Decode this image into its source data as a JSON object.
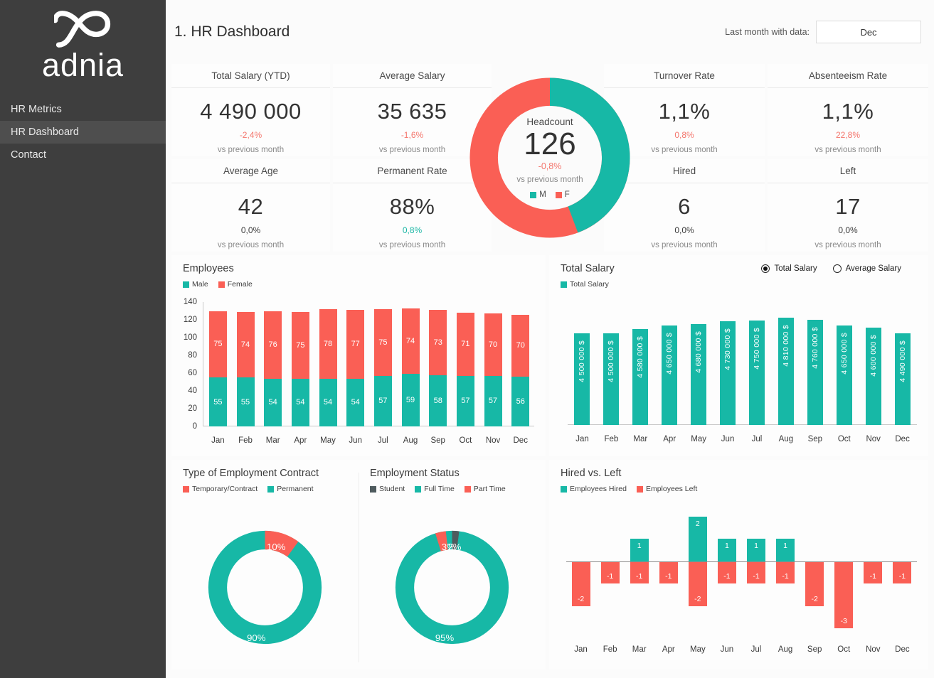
{
  "brand": {
    "name": "adnia",
    "logo_icon": "adnia-logo-icon"
  },
  "sidebar": {
    "items": [
      {
        "label": "HR Metrics",
        "active": false
      },
      {
        "label": "HR Dashboard",
        "active": true
      },
      {
        "label": "Contact",
        "active": false
      }
    ]
  },
  "header": {
    "title": "1. HR Dashboard",
    "month_label": "Last month with data:",
    "month_value": "Dec"
  },
  "colors": {
    "teal": "#17b8a6",
    "red": "#fa5f55",
    "dark_gray": "#4f5b5e",
    "sidebar": "#3e3e3e",
    "sidebar_active": "#4e4e4e"
  },
  "kpis": {
    "left": [
      {
        "title": "Total Salary (YTD)",
        "value": "4 490 000",
        "delta": "-2,4%",
        "delta_type": "neg",
        "sub": "vs previous month"
      },
      {
        "title": "Average Salary",
        "value": "35 635",
        "delta": "-1,6%",
        "delta_type": "neg",
        "sub": "vs previous month"
      },
      {
        "title": "Average Age",
        "value": "42",
        "delta": "0,0%",
        "delta_type": "flat",
        "sub": "vs previous month"
      },
      {
        "title": "Permanent Rate",
        "value": "88%",
        "delta": "0,8%",
        "delta_type": "pos",
        "sub": "vs previous month"
      }
    ],
    "right": [
      {
        "title": "Turnover Rate",
        "value": "1,1%",
        "delta": "0,8%",
        "delta_type": "neg",
        "sub": "vs previous month"
      },
      {
        "title": "Absenteeism Rate",
        "value": "1,1%",
        "delta": "22,8%",
        "delta_type": "neg",
        "sub": "vs previous month"
      },
      {
        "title": "Hired",
        "value": "6",
        "delta": "0,0%",
        "delta_type": "flat",
        "sub": "vs previous month"
      },
      {
        "title": "Left",
        "value": "17",
        "delta": "0,0%",
        "delta_type": "flat",
        "sub": "vs previous month"
      }
    ]
  },
  "headcount": {
    "label": "Headcount",
    "value": "126",
    "delta": "-0,8%",
    "sub": "vs previous month",
    "legend": [
      {
        "label": "M",
        "color": "#17b8a6"
      },
      {
        "label": "F",
        "color": "#fa5f55"
      }
    ],
    "chart_data": {
      "type": "pie",
      "title": "Headcount",
      "categories": [
        "M",
        "F"
      ],
      "values": [
        56,
        70
      ],
      "colors": [
        "#17b8a6",
        "#fa5f55"
      ]
    }
  },
  "charts": {
    "employees": {
      "title": "Employees",
      "legend": [
        {
          "label": "Male",
          "color": "#17b8a6"
        },
        {
          "label": "Female",
          "color": "#fa5f55"
        }
      ],
      "chart_data": {
        "type": "bar",
        "stacked": true,
        "title": "Employees",
        "categories": [
          "Jan",
          "Feb",
          "Mar",
          "Apr",
          "May",
          "Jun",
          "Jul",
          "Aug",
          "Sep",
          "Oct",
          "Nov",
          "Dec"
        ],
        "series": [
          {
            "name": "Male",
            "color": "#17b8a6",
            "values": [
              55,
              55,
              54,
              54,
              54,
              54,
              57,
              59,
              58,
              57,
              57,
              56
            ]
          },
          {
            "name": "Female",
            "color": "#fa5f55",
            "values": [
              75,
              74,
              76,
              75,
              78,
              77,
              75,
              74,
              73,
              71,
              70,
              70
            ]
          }
        ],
        "yticks": [
          0,
          20,
          40,
          60,
          80,
          100,
          120,
          140
        ],
        "ylim": [
          0,
          140
        ],
        "xlabel": "",
        "ylabel": "",
        "grid": false,
        "legend_position": "top-left"
      }
    },
    "total_salary": {
      "title": "Total Salary",
      "legend": [
        {
          "label": "Total Salary",
          "color": "#17b8a6"
        }
      ],
      "options": [
        {
          "label": "Total Salary",
          "selected": true
        },
        {
          "label": "Average Salary",
          "selected": false
        }
      ],
      "chart_data": {
        "type": "bar",
        "title": "Total Salary",
        "categories": [
          "Jan",
          "Feb",
          "Mar",
          "Apr",
          "May",
          "Jun",
          "Jul",
          "Aug",
          "Sep",
          "Oct",
          "Nov",
          "Dec"
        ],
        "values": [
          4500000,
          4500000,
          4580000,
          4650000,
          4680000,
          4730000,
          4750000,
          4810000,
          4760000,
          4650000,
          4600000,
          4490000
        ],
        "data_labels": [
          "4 500 000 $",
          "4 500 000 $",
          "4 580 000 $",
          "4 650 000 $",
          "4 680 000 $",
          "4 730 000 $",
          "4 750 000 $",
          "4 810 000 $",
          "4 760 000 $",
          "4 650 000 $",
          "4 600 000 $",
          "4 490 000 $"
        ],
        "series": [
          {
            "name": "Total Salary",
            "color": "#17b8a6"
          }
        ],
        "xlabel": "",
        "ylabel": "",
        "grid": false,
        "legend_position": "top-left"
      }
    },
    "contract_type": {
      "title": "Type of Employment Contract",
      "legend": [
        {
          "label": "Temporary/Contract",
          "color": "#fa5f55"
        },
        {
          "label": "Permanent",
          "color": "#17b8a6"
        }
      ],
      "chart_data": {
        "type": "pie",
        "title": "Type of Employment Contract",
        "categories": [
          "Temporary/Contract",
          "Permanent"
        ],
        "values": [
          10,
          90
        ],
        "data_labels": [
          "10%",
          "90%"
        ],
        "colors": [
          "#fa5f55",
          "#17b8a6"
        ]
      }
    },
    "employment_status": {
      "title": "Employment Status",
      "legend": [
        {
          "label": "Student",
          "color": "#4f5b5e"
        },
        {
          "label": "Full Time",
          "color": "#17b8a6"
        },
        {
          "label": "Part Time",
          "color": "#fa5f55"
        }
      ],
      "chart_data": {
        "type": "pie",
        "title": "Employment Status",
        "categories": [
          "Student",
          "Full Time",
          "Part Time"
        ],
        "values": [
          2,
          95,
          3
        ],
        "data_labels": [
          "2%",
          "95%",
          "3%"
        ],
        "colors": [
          "#4f5b5e",
          "#17b8a6",
          "#fa5f55"
        ]
      }
    },
    "hired_vs_left": {
      "title": "Hired vs. Left",
      "legend": [
        {
          "label": "Employees Hired",
          "color": "#17b8a6"
        },
        {
          "label": "Employees Left",
          "color": "#fa5f55"
        }
      ],
      "chart_data": {
        "type": "bar",
        "title": "Hired vs. Left",
        "categories": [
          "Jan",
          "Feb",
          "Mar",
          "Apr",
          "May",
          "Jun",
          "Jul",
          "Aug",
          "Sep",
          "Oct",
          "Nov",
          "Dec"
        ],
        "series": [
          {
            "name": "Employees Hired",
            "color": "#17b8a6",
            "values": [
              0,
              0,
              1,
              0,
              2,
              1,
              1,
              1,
              0,
              0,
              0,
              0
            ]
          },
          {
            "name": "Employees Left",
            "color": "#fa5f55",
            "values": [
              -2,
              -1,
              -1,
              -1,
              -2,
              -1,
              -1,
              -1,
              -2,
              -3,
              -1,
              -1
            ]
          }
        ],
        "ylim": [
          -3,
          2
        ],
        "grid": false,
        "legend_position": "top-left"
      }
    }
  }
}
